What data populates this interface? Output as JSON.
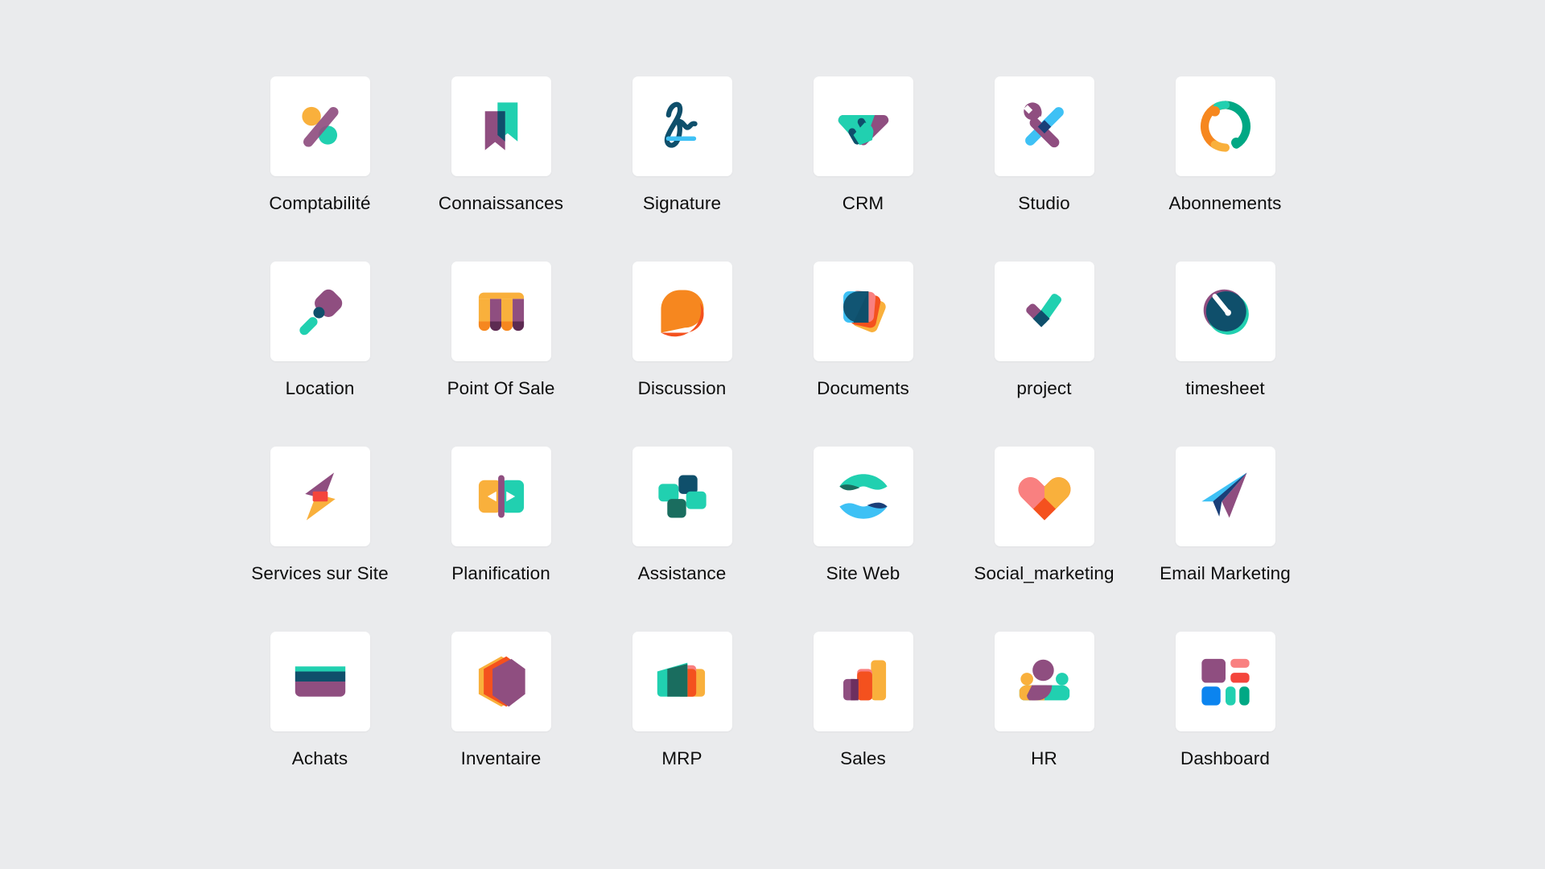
{
  "page": {
    "background_color": "#eaebed",
    "tile_color": "#ffffff",
    "label_color": "#0d0d0d",
    "columns": 6,
    "rows": 4
  },
  "palette": {
    "purple": "#8f4e80",
    "purple_dark": "#714177",
    "teal": "#21d0b0",
    "teal_dark": "#17a58d",
    "green_teal": "#00a884",
    "navy": "#0f4f6b",
    "navy_dark": "#1a3f78",
    "blue": "#3ec1f5",
    "blue_strong": "#0b84ef",
    "orange": "#f6871f",
    "orange_deep": "#f4511e",
    "amber": "#f9b03c",
    "yellow": "#fbb040",
    "red": "#f4453c",
    "pink": "#f98080",
    "white": "#ffffff"
  },
  "apps": [
    {
      "id": "accounting",
      "label": "Comptabilité",
      "icon": "percent-shapes-icon",
      "row": 1,
      "col": 1
    },
    {
      "id": "knowledge",
      "label": "Connaissances",
      "icon": "bookmark-icon",
      "row": 1,
      "col": 2
    },
    {
      "id": "sign",
      "label": "Signature",
      "icon": "signature-icon",
      "row": 1,
      "col": 3
    },
    {
      "id": "crm",
      "label": "CRM",
      "icon": "handshake-icon",
      "row": 1,
      "col": 4
    },
    {
      "id": "studio",
      "label": "Studio",
      "icon": "wrench-screwdriver-icon",
      "row": 1,
      "col": 5
    },
    {
      "id": "subscriptions",
      "label": "Abonnements",
      "icon": "recycle-circle-icon",
      "row": 1,
      "col": 6
    },
    {
      "id": "rental",
      "label": "Location",
      "icon": "key-icon",
      "row": 2,
      "col": 1
    },
    {
      "id": "point_of_sale",
      "label": "Point Of Sale",
      "icon": "awning-icon",
      "row": 2,
      "col": 2
    },
    {
      "id": "discuss",
      "label": "Discussion",
      "icon": "speech-bubble-icon",
      "row": 2,
      "col": 3
    },
    {
      "id": "documents",
      "label": "Documents",
      "icon": "stacked-cards-icon",
      "row": 2,
      "col": 4
    },
    {
      "id": "project",
      "label": "project",
      "icon": "check-mark-icon",
      "row": 2,
      "col": 5
    },
    {
      "id": "timesheet",
      "label": "timesheet",
      "icon": "clock-gauge-icon",
      "row": 2,
      "col": 6
    },
    {
      "id": "field_service",
      "label": "Services sur Site",
      "icon": "lightning-bolt-icon",
      "row": 3,
      "col": 1
    },
    {
      "id": "planning",
      "label": "Planification",
      "icon": "play-split-icon",
      "row": 3,
      "col": 2
    },
    {
      "id": "helpdesk",
      "label": "Assistance",
      "icon": "pinwheel-cross-icon",
      "row": 3,
      "col": 3
    },
    {
      "id": "website",
      "label": "Site Web",
      "icon": "wave-globe-icon",
      "row": 3,
      "col": 4
    },
    {
      "id": "social_marketing",
      "label": "Social_marketing",
      "icon": "heart-icon",
      "row": 3,
      "col": 5
    },
    {
      "id": "email_marketing",
      "label": "Email Marketing",
      "icon": "paper-plane-icon",
      "row": 3,
      "col": 6
    },
    {
      "id": "purchase",
      "label": "Achats",
      "icon": "credit-card-icon",
      "row": 4,
      "col": 1
    },
    {
      "id": "inventory",
      "label": "Inventaire",
      "icon": "hexagon-box-icon",
      "row": 4,
      "col": 2
    },
    {
      "id": "mrp",
      "label": "MRP",
      "icon": "layered-panels-icon",
      "row": 4,
      "col": 3
    },
    {
      "id": "sales",
      "label": "Sales",
      "icon": "bar-chart-icon",
      "row": 4,
      "col": 4
    },
    {
      "id": "hr",
      "label": "HR",
      "icon": "people-group-icon",
      "row": 4,
      "col": 5
    },
    {
      "id": "dashboard",
      "label": "Dashboard",
      "icon": "tile-grid-icon",
      "row": 4,
      "col": 6
    }
  ]
}
